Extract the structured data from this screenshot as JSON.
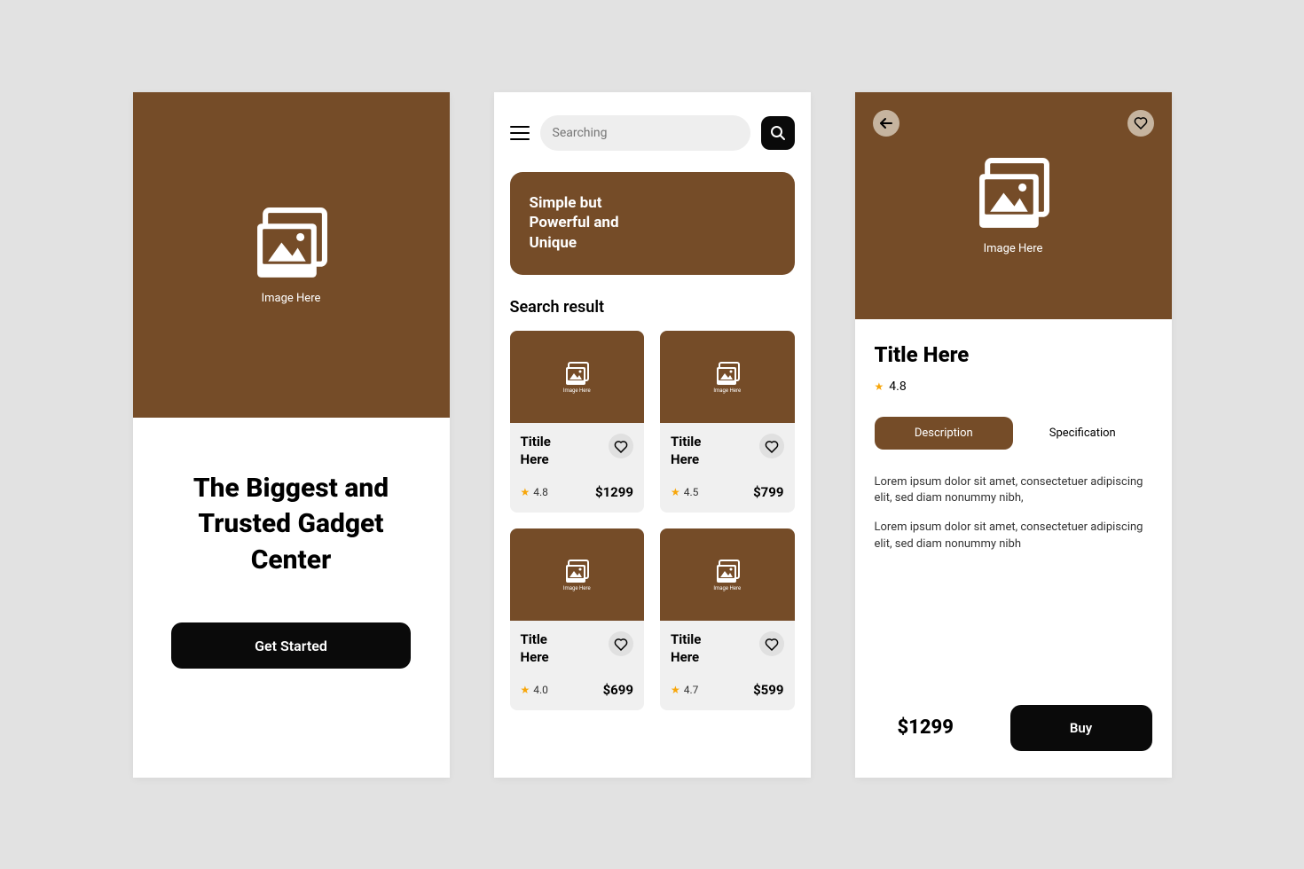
{
  "screen1": {
    "image_caption": "Image Here",
    "headline": "The Biggest and Trusted Gadget Center",
    "cta": "Get Started"
  },
  "screen2": {
    "search_placeholder": "Searching",
    "banner_line1": "Simple but",
    "banner_line2": "Powerful and",
    "banner_line3": "Unique",
    "results_heading": "Search result",
    "image_caption": "Image Here",
    "products": [
      {
        "title_l1": "Titile",
        "title_l2": "Here",
        "rating": "4.8",
        "price": "$1299"
      },
      {
        "title_l1": "Titile",
        "title_l2": "Here",
        "rating": "4.5",
        "price": "$799"
      },
      {
        "title_l1": "Title",
        "title_l2": "Here",
        "rating": "4.0",
        "price": "$699"
      },
      {
        "title_l1": "Titile",
        "title_l2": "Here",
        "rating": "4.7",
        "price": "$599"
      }
    ]
  },
  "screen3": {
    "image_caption": "Image Here",
    "title": "Title Here",
    "rating": "4.8",
    "tab_description": "Description",
    "tab_specification": "Specification",
    "para1": "Lorem ipsum dolor sit amet, consectetuer adipiscing elit, sed diam nonummy nibh,",
    "para2": "Lorem ipsum dolor sit amet, consectetuer adipiscing elit, sed diam nonummy nibh",
    "price": "$1299",
    "buy": "Buy"
  }
}
